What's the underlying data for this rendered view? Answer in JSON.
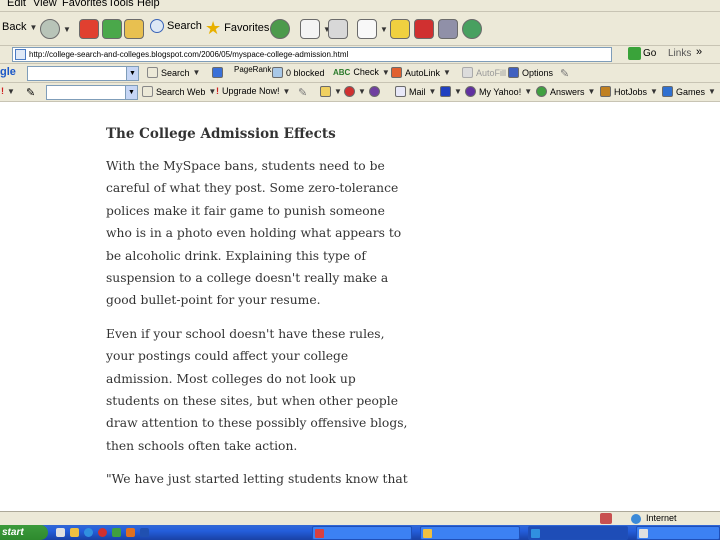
{
  "menu": {
    "edit": "Edit",
    "view": "View",
    "favorites": "Favorites",
    "tools": "Tools",
    "help": "Help"
  },
  "toolbar": {
    "back": "Back",
    "search": "Search",
    "favorites": "Favorites"
  },
  "address": {
    "url": "http://college-search-and-colleges.blogspot.com/2006/05/myspace-college-admission.html",
    "go": "Go",
    "links": "Links",
    "more": "»"
  },
  "google_toolbar": {
    "logo": "gle",
    "search": "Search",
    "pagerank": "PageRank",
    "blocked": "0 blocked",
    "check": "Check",
    "autolink": "AutoLink",
    "autofill": "AutoFill",
    "options": "Options"
  },
  "yahoo_toolbar": {
    "search_web": "Search Web",
    "upgrade": "Upgrade Now!",
    "mail": "Mail",
    "my_yahoo": "My Yahoo!",
    "answers": "Answers",
    "hotjobs": "HotJobs",
    "games": "Games"
  },
  "article": {
    "heading": "The College Admission Effects",
    "paragraphs": [
      [
        "With the MySpace bans, students need to be",
        "careful of what they post. Some zero-tolerance",
        "polices make it fair game to punish someone",
        "who is in a photo even holding what appears to",
        "be alcoholic drink. Explaining this type of",
        "suspension to a college doesn't really make a",
        "good bullet-point for your resume."
      ],
      [
        "Even if your school doesn't have these rules,",
        "your postings could affect your college",
        "admission. Most colleges do not look up",
        "students on these sites, but when other people",
        "draw attention to these possibly offensive blogs,",
        "then schools often take action."
      ],
      [
        "\"We have just started letting students know that"
      ]
    ]
  },
  "status": {
    "zone": "Internet"
  },
  "taskbar": {
    "start": "start"
  }
}
